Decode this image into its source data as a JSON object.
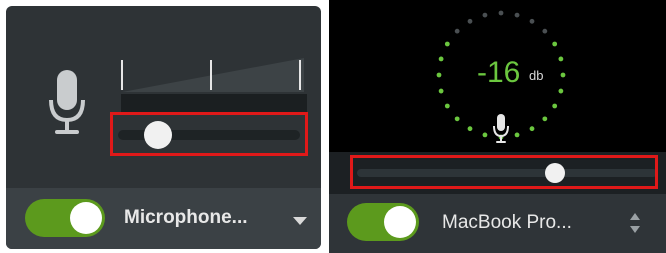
{
  "left_panel": {
    "device": {
      "label": "Microphone...",
      "toggle_on": true,
      "icon": "chevron-down-icon"
    },
    "volume_slider": {
      "value": 0.22,
      "highlighted": true
    },
    "level_meter": {
      "tick_count": 3
    },
    "mic_icon": "microphone-icon"
  },
  "right_panel": {
    "level": {
      "value": "-16",
      "unit": "db"
    },
    "volume_slider": {
      "value": 0.66,
      "highlighted": true
    },
    "device": {
      "label": "MacBook Pro...",
      "toggle_on": true,
      "icon": "up-down-stepper-icon"
    },
    "mic_icon": "microphone-icon"
  },
  "colors": {
    "accent_green": "#5c9a1d",
    "meter_green": "#6bc73f",
    "highlight_red": "#e01919",
    "panel_dark": "#2e3336"
  }
}
